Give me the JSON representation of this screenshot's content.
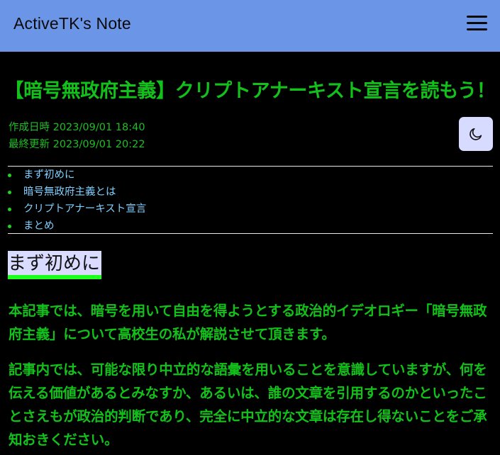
{
  "site": {
    "brand": "ActiveTK's Note",
    "nav_icon": "hamburger-menu-icon"
  },
  "article": {
    "title": "【暗号無政府主義】クリプトアナーキスト宣言を読もう！",
    "created": "作成日時 2023/09/01 18:40",
    "updated": "最終更新 2023/09/01 20:22",
    "theme_toggle_icon": "moon-icon",
    "toc": [
      {
        "label": "まず初めに"
      },
      {
        "label": "暗号無政府主義とは"
      },
      {
        "label": "クリプトアナーキスト宣言"
      },
      {
        "label": "まとめ"
      }
    ],
    "section_heading": "まず初めに",
    "paragraphs": [
      "本記事では、暗号を用いて自由を得ようとする政治的イデオロギー「暗号無政府主義」について高校生の私が解説させて頂きます。",
      "記事内では、可能な限り中立的な語彙を用いることを意識していますが、何を伝える価値があるとみなすか、あるいは、誰の文章を引用するのかといったことさえもが政治的判断であり、完全に中立的な文章は存在し得ないことをご承知おきください。"
    ]
  },
  "colors": {
    "navbar": "#6b96e8",
    "background": "#000000",
    "text_green": "#12c21a",
    "link_blue": "#7fd0ff",
    "heading_bg": "#d9dcff",
    "heading_underline": "#1dff1d",
    "toggle_bg": "#d7dbff"
  }
}
